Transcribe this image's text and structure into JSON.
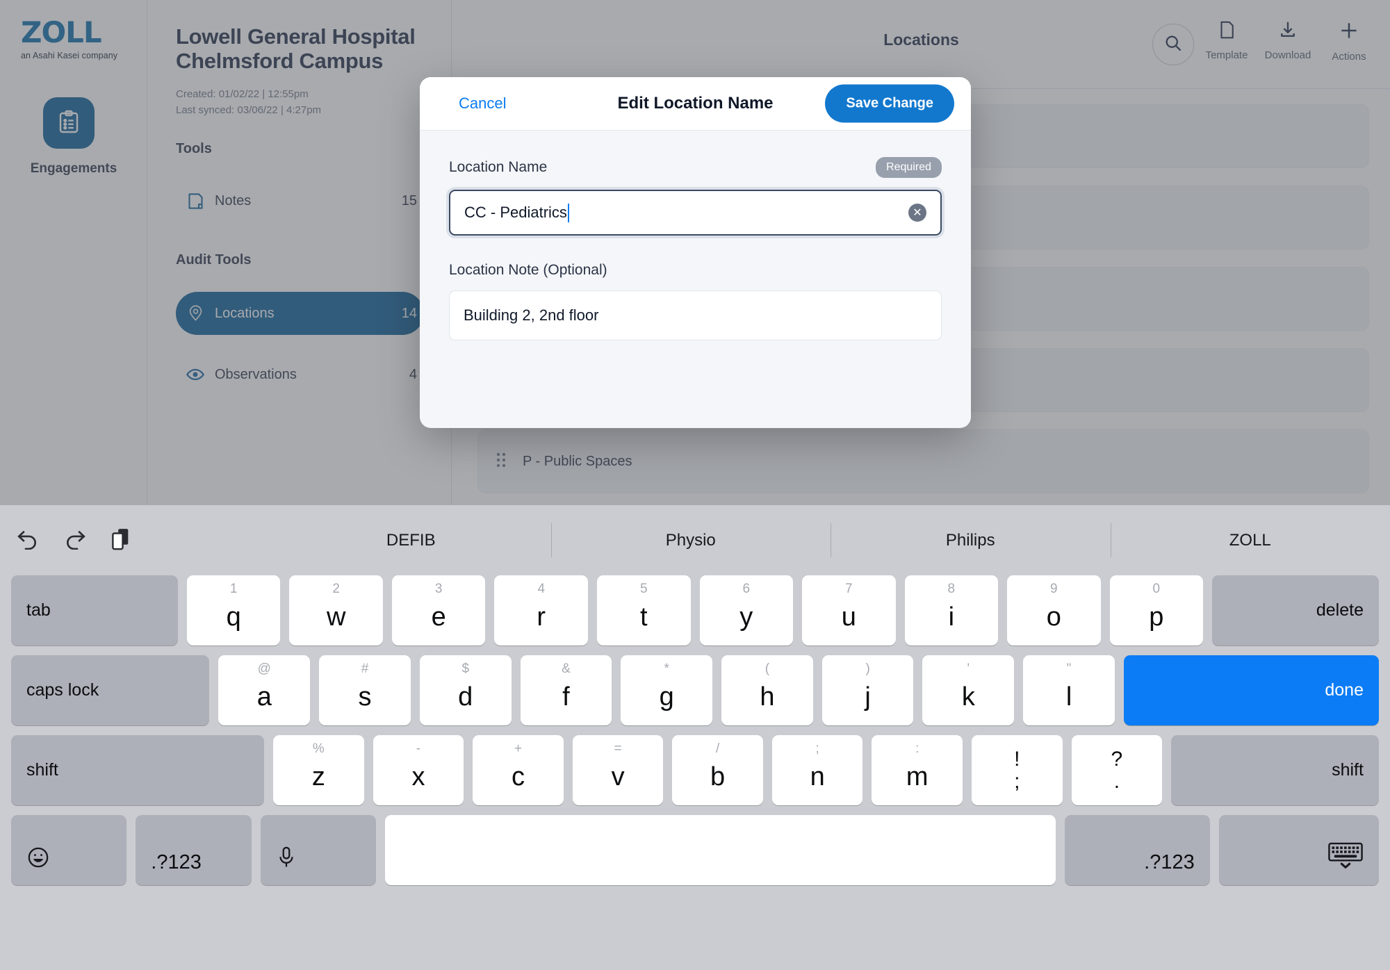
{
  "rail": {
    "logo_word": "ZOLL",
    "logo_tagline": "an Asahi Kasei company",
    "tile_icon": "clipboard-checklist-icon",
    "label": "Engagements"
  },
  "engagement": {
    "title": "Lowell General Hospital Chelmsford Campus",
    "created": "Created: 01/02/22 | 12:55pm",
    "last_synced": "Last synced: 03/06/22 | 4:27pm",
    "sections": [
      {
        "heading": "Tools",
        "items": [
          {
            "icon": "note-icon",
            "label": "Notes",
            "count": "15",
            "active": false
          }
        ]
      },
      {
        "heading": "Audit Tools",
        "items": [
          {
            "icon": "map-pin-icon",
            "label": "Locations",
            "count": "14",
            "active": true
          },
          {
            "icon": "eye-icon",
            "label": "Observations",
            "count": "4",
            "active": false
          }
        ]
      }
    ]
  },
  "main": {
    "title": "Locations",
    "search_icon": "search-icon",
    "actions": [
      {
        "icon": "document-icon",
        "label": "Template"
      },
      {
        "icon": "download-icon",
        "label": "Download"
      },
      {
        "icon": "plus-icon",
        "label": "Actions"
      }
    ],
    "locations": [
      {
        "name": ""
      },
      {
        "name": ""
      },
      {
        "name": ""
      },
      {
        "name": ""
      },
      {
        "name": "P - Public Spaces"
      }
    ]
  },
  "modal": {
    "cancel_label": "Cancel",
    "title": "Edit Location Name",
    "save_label": "Save Change",
    "name_field": {
      "label": "Location Name",
      "badge": "Required",
      "value": "CC - Pediatrics",
      "placeholder": "Location Name",
      "clear_icon": "clear-circle-icon"
    },
    "note_field": {
      "label": "Location Note (Optional)",
      "value": "Building 2, 2nd floor",
      "placeholder": "Location Note"
    }
  },
  "keyboard": {
    "tools": [
      "undo-icon",
      "redo-icon",
      "paste-icon"
    ],
    "suggestions": [
      "DEFIB",
      "Physio",
      "Philips",
      "ZOLL"
    ],
    "row1": [
      {
        "label": "tab",
        "type": "mod",
        "align": "left",
        "flex": 1.62
      },
      {
        "label": "q",
        "alt": "1",
        "type": "letter"
      },
      {
        "label": "w",
        "alt": "2",
        "type": "letter"
      },
      {
        "label": "e",
        "alt": "3",
        "type": "letter"
      },
      {
        "label": "r",
        "alt": "4",
        "type": "letter"
      },
      {
        "label": "t",
        "alt": "5",
        "type": "letter"
      },
      {
        "label": "y",
        "alt": "6",
        "type": "letter"
      },
      {
        "label": "u",
        "alt": "7",
        "type": "letter"
      },
      {
        "label": "i",
        "alt": "8",
        "type": "letter"
      },
      {
        "label": "o",
        "alt": "9",
        "type": "letter"
      },
      {
        "label": "p",
        "alt": "0",
        "type": "letter"
      },
      {
        "label": "delete",
        "type": "mod",
        "align": "right",
        "flex": 1.62
      }
    ],
    "row2": [
      {
        "label": "caps lock",
        "type": "mod",
        "align": "left",
        "flex": 2.0
      },
      {
        "label": "a",
        "alt": "@",
        "type": "letter"
      },
      {
        "label": "s",
        "alt": "#",
        "type": "letter"
      },
      {
        "label": "d",
        "alt": "$",
        "type": "letter"
      },
      {
        "label": "f",
        "alt": "&",
        "type": "letter"
      },
      {
        "label": "g",
        "alt": "*",
        "type": "letter"
      },
      {
        "label": "h",
        "alt": "(",
        "type": "letter"
      },
      {
        "label": "j",
        "alt": ")",
        "type": "letter"
      },
      {
        "label": "k",
        "alt": "'",
        "type": "letter"
      },
      {
        "label": "l",
        "alt": "\"",
        "type": "letter"
      },
      {
        "label": "done",
        "type": "done",
        "align": "right",
        "flex": 2.62
      }
    ],
    "row3": [
      {
        "label": "shift",
        "type": "mod",
        "align": "left",
        "flex": 2.62
      },
      {
        "label": "z",
        "alt": "%",
        "type": "letter"
      },
      {
        "label": "x",
        "alt": "-",
        "type": "letter"
      },
      {
        "label": "c",
        "alt": "+",
        "type": "letter"
      },
      {
        "label": "v",
        "alt": "=",
        "type": "letter"
      },
      {
        "label": "b",
        "alt": "/",
        "type": "letter"
      },
      {
        "label": "n",
        "alt": ";",
        "type": "letter"
      },
      {
        "label": "m",
        "alt": ":",
        "type": "letter"
      },
      {
        "label": "!",
        "lower": ";",
        "type": "dual"
      },
      {
        "label": "?",
        "lower": ".",
        "type": "dual"
      },
      {
        "label": "shift",
        "type": "mod",
        "align": "right",
        "flex": 2.12
      }
    ],
    "row4": [
      {
        "label": "emoji-icon",
        "type": "icon-mod",
        "flex": 1.33
      },
      {
        "label": ".?123",
        "type": "mod",
        "align": "bleft",
        "flex": 1.33
      },
      {
        "label": "microphone-icon",
        "type": "icon-mod",
        "flex": 1.33
      },
      {
        "label": "",
        "type": "space",
        "flex": 8.9
      },
      {
        "label": ".?123",
        "type": "mod",
        "align": "bright",
        "flex": 1.72
      },
      {
        "label": "hide-keyboard-icon",
        "type": "icon-mod",
        "flex": 1.92
      }
    ]
  },
  "colors": {
    "brand_blue": "#0a5c94",
    "accent_blue": "#1278ce",
    "link_blue": "#0a7cf0",
    "done_blue": "#0b7cf6",
    "keyboard_bg": "#cbccd1",
    "key_mod": "#adb0b9"
  }
}
